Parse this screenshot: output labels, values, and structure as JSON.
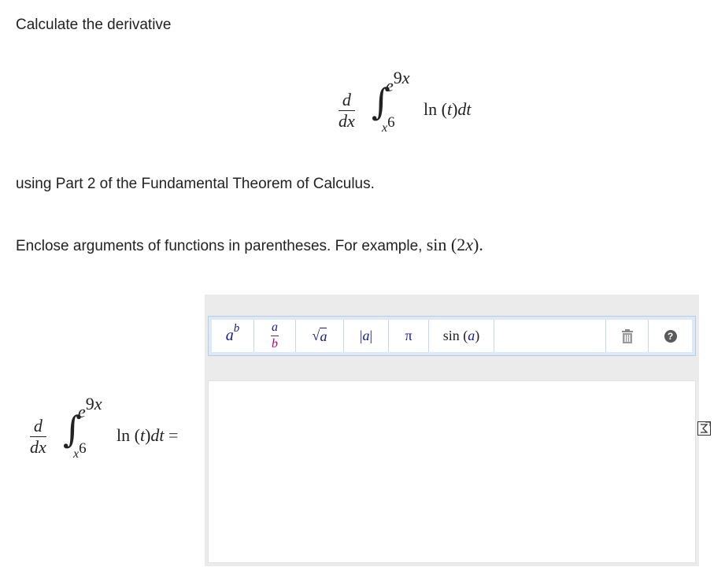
{
  "question": {
    "intro": "Calculate the derivative",
    "method": "using Part 2 of the Fundamental Theorem of Calculus.",
    "hint_text": "Enclose arguments of functions in parentheses. For example,",
    "hint_example": "sin (2x).",
    "hint_sin": "sin",
    "hint_arg": "(2",
    "hint_x": "x",
    "hint_close": ")."
  },
  "integral": {
    "d": "d",
    "dx_d": "d",
    "dx_x": "x",
    "upper_base": "e",
    "upper_exp_num": "9",
    "upper_exp_var": "x",
    "lower_var": "x",
    "lower_exp": "6",
    "integrand_fn": "ln",
    "integrand_open": "(",
    "integrand_var": "t",
    "integrand_close": ")",
    "integrand_dt_d": "d",
    "integrand_dt_t": "t",
    "equals": "="
  },
  "toolbar": {
    "superscript": {
      "base": "a",
      "exp": "b"
    },
    "fraction": {
      "num": "a",
      "den": "b"
    },
    "sqrt": {
      "sym": "√",
      "arg": "a"
    },
    "abs": {
      "open": "|",
      "arg": "a",
      "close": "|"
    },
    "pi": "π",
    "sin": {
      "fn": "sin",
      "open": "(",
      "arg": "a",
      "close": ")"
    },
    "trash_icon": "trash-icon",
    "help_icon": "help-icon",
    "help_glyph": "?"
  },
  "answer": {
    "value": ""
  },
  "colors": {
    "toolbar_bg": "#dde9f5",
    "editor_bg": "#ebebeb",
    "accent": "#1a1a8a",
    "fraction_a": "#1a1a8a",
    "fraction_b": "#c0007a"
  }
}
